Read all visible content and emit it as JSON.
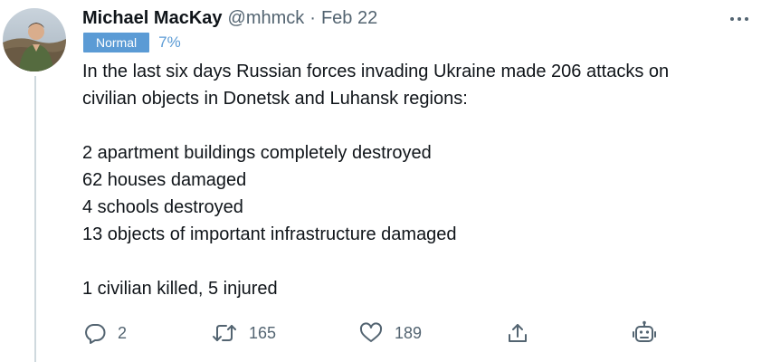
{
  "tweet": {
    "author_name": "Michael MacKay",
    "handle": "@mhmck",
    "separator": "·",
    "date": "Feb 22",
    "badge_label": "Normal",
    "badge_percent": "7%",
    "lines": [
      "In the last six days Russian forces invading Ukraine made 206 attacks on",
      "civilian objects in Donetsk and Luhansk regions:",
      "2 apartment buildings completely destroyed",
      "62 houses damaged",
      "4 schools destroyed",
      "13 objects of important infrastructure damaged",
      "1 civilian killed, 5 injured"
    ],
    "replies": "2",
    "retweets": "165",
    "likes": "189"
  },
  "icons": {
    "more": "more-icon",
    "reply": "reply-icon",
    "retweet": "retweet-icon",
    "like": "heart-icon",
    "share": "share-icon",
    "bot": "robot-icon"
  },
  "colors": {
    "text": "#0f1419",
    "secondary": "#536471",
    "badge": "#5b9bd5",
    "thread_line": "#cfd9de"
  }
}
